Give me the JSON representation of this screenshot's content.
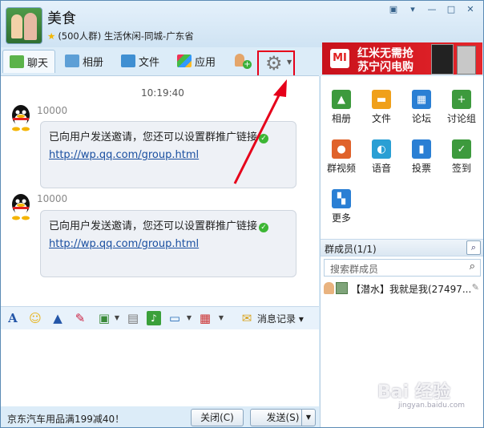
{
  "header": {
    "group_name": "美食",
    "group_info": "(500人群) 生活休闲-同城-广东省",
    "window_controls": [
      "▣",
      "▾",
      "—",
      "□",
      "✕"
    ]
  },
  "tabs": [
    {
      "label": "聊天",
      "icon": "chat-icon"
    },
    {
      "label": "相册",
      "icon": "photo-icon"
    },
    {
      "label": "文件",
      "icon": "folder-icon"
    },
    {
      "label": "应用",
      "icon": "apps-icon"
    }
  ],
  "ad": {
    "logo": "MI",
    "line1": "红米无需抢",
    "line2": "苏宁闪电购"
  },
  "chat": {
    "timestamp": "10:19:40",
    "messages": [
      {
        "sender": "10000",
        "text": "已向用户发送邀请，您还可以设置群推广链接",
        "link": "http://wp.qq.com/group.html"
      },
      {
        "sender": "10000",
        "text": "已向用户发送邀请，您还可以设置群推广链接",
        "link": "http://wp.qq.com/group.html"
      }
    ]
  },
  "input_toolbar": {
    "history_label": "消息记录"
  },
  "footer": {
    "promo": "京东汽车用品满199减40！",
    "close_label": "关闭(C)",
    "send_label": "发送(S)"
  },
  "sidebar": {
    "apps": [
      {
        "label": "相册",
        "icon": "album-icon",
        "color": "#3d9a3d"
      },
      {
        "label": "文件",
        "icon": "file-icon",
        "color": "#f0a01a"
      },
      {
        "label": "论坛",
        "icon": "forum-icon",
        "color": "#2a7fd4"
      },
      {
        "label": "讨论组",
        "icon": "discussion-icon",
        "color": "#3d9a3d"
      },
      {
        "label": "群视频",
        "icon": "video-icon",
        "color": "#e0622a"
      },
      {
        "label": "语音",
        "icon": "voice-icon",
        "color": "#2a9fd4"
      },
      {
        "label": "投票",
        "icon": "vote-icon",
        "color": "#2a7fd4"
      },
      {
        "label": "签到",
        "icon": "checkin-icon",
        "color": "#3d9a3d"
      },
      {
        "label": "更多",
        "icon": "more-icon",
        "color": "#2a7fd4"
      }
    ],
    "members_title": "群成员(1/1)",
    "search_placeholder": "搜索群成员",
    "member": {
      "name": "【潜水】我就是我(27497...",
      "edit_icon": "✎"
    }
  },
  "watermark": {
    "text": "Bai 经验",
    "sub": "jingyan.baidu.com"
  }
}
